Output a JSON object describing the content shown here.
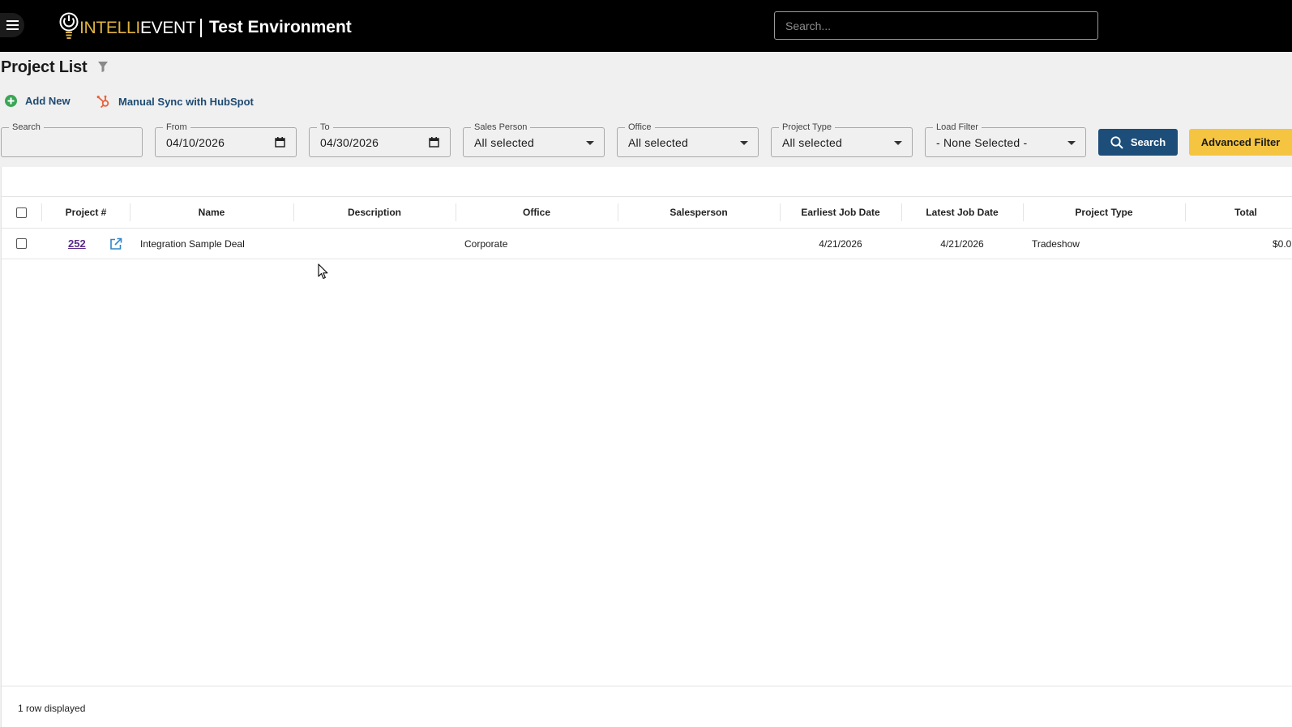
{
  "header": {
    "logo_text_accent": "INTELLI",
    "logo_text_main": "EVENT",
    "environment": "Test Environment",
    "search_placeholder": "Search...",
    "menu_icon": "hamburger-icon"
  },
  "page": {
    "title": "Project List",
    "title_icon": "filter-icon"
  },
  "actions": {
    "add_new": "Add New",
    "hubspot_sync": "Manual Sync with HubSpot"
  },
  "filters": {
    "search": {
      "label": "Search",
      "value": ""
    },
    "from": {
      "label": "From",
      "value": "04/10/2026"
    },
    "to": {
      "label": "To",
      "value": "04/30/2026"
    },
    "sales_person": {
      "label": "Sales Person",
      "value": "All selected"
    },
    "office": {
      "label": "Office",
      "value": "All selected"
    },
    "project_type": {
      "label": "Project Type",
      "value": "All selected"
    },
    "load_filter": {
      "label": "Load Filter",
      "value": "- None Selected -"
    },
    "search_button": "Search",
    "advanced_button": "Advanced Filter"
  },
  "table": {
    "columns": [
      "Project #",
      "Name",
      "Description",
      "Office",
      "Salesperson",
      "Earliest Job Date",
      "Latest Job Date",
      "Project Type",
      "Total"
    ],
    "rows": [
      {
        "project_no": "252",
        "name": "Integration Sample Deal",
        "description": "",
        "office": "Corporate",
        "salesperson": "",
        "earliest_job_date": "4/21/2026",
        "latest_job_date": "4/21/2026",
        "project_type": "Tradeshow",
        "total": "$0.0"
      }
    ],
    "footer": "1 row displayed"
  },
  "colors": {
    "header_bg": "#000000",
    "accent_gold": "#e0b341",
    "primary_blue": "#1d4e79",
    "advanced_yellow": "#f5c541",
    "link_purple": "#5a2a88",
    "add_green": "#3aa655",
    "hubspot_orange": "#e8603c"
  }
}
